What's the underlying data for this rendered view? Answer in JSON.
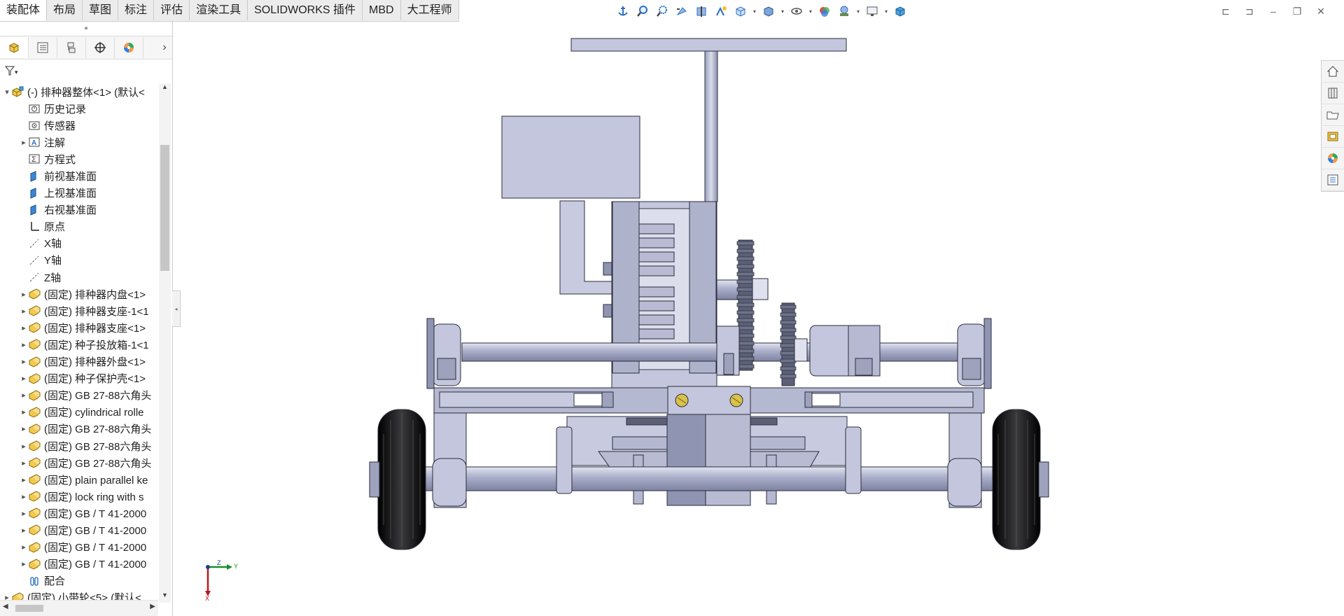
{
  "tabs": [
    "装配体",
    "布局",
    "草图",
    "标注",
    "评估",
    "渲染工具",
    "SOLIDWORKS 插件",
    "MBD",
    "大工程师"
  ],
  "active_tab": "装配体",
  "heads_up_toolbar": [
    "anchor-icon",
    "zoom-to-fit-icon",
    "zoom-area-icon",
    "previous-view-icon",
    "section-view-icon",
    "dynamic-annotation-icon",
    "view-orientation-icon",
    "display-style-icon",
    "hide-show-icon",
    "edit-appearance-icon",
    "apply-scene-icon",
    "view-settings-icon",
    "3d-view-icon"
  ],
  "panel_tabs": [
    "featuremanager-icon",
    "propertymanager-icon",
    "configurationmanager-icon",
    "dimxpert-icon",
    "display-manager-icon"
  ],
  "tree": {
    "root": "(-) 排种器整体<1> (默认<",
    "items": [
      {
        "label": "历史记录",
        "icon": "history-icon",
        "expandable": false
      },
      {
        "label": "传感器",
        "icon": "sensor-icon",
        "expandable": false
      },
      {
        "label": "注解",
        "icon": "annotation-icon",
        "expandable": true
      },
      {
        "label": "方程式",
        "icon": "equation-icon",
        "expandable": false
      },
      {
        "label": "前视基准面",
        "icon": "plane-icon",
        "expandable": false
      },
      {
        "label": "上视基准面",
        "icon": "plane-icon",
        "expandable": false
      },
      {
        "label": "右视基准面",
        "icon": "plane-icon",
        "expandable": false
      },
      {
        "label": "原点",
        "icon": "origin-icon",
        "expandable": false
      },
      {
        "label": "X轴",
        "icon": "axis-icon",
        "expandable": false
      },
      {
        "label": "Y轴",
        "icon": "axis-icon",
        "expandable": false
      },
      {
        "label": "Z轴",
        "icon": "axis-icon",
        "expandable": false
      },
      {
        "label": "(固定) 排种器内盘<1>",
        "icon": "part-icon",
        "expandable": true
      },
      {
        "label": "(固定) 排种器支座-1<1",
        "icon": "part-icon",
        "expandable": true
      },
      {
        "label": "(固定) 排种器支座<1>",
        "icon": "part-icon",
        "expandable": true
      },
      {
        "label": "(固定) 种子投放箱-1<1",
        "icon": "part-icon",
        "expandable": true
      },
      {
        "label": "(固定) 排种器外盘<1>",
        "icon": "part-icon",
        "expandable": true
      },
      {
        "label": "(固定) 种子保护壳<1>",
        "icon": "part-icon",
        "expandable": true
      },
      {
        "label": "(固定) GB 27-88六角头",
        "icon": "part-icon",
        "expandable": true
      },
      {
        "label": "(固定) cylindrical rolle",
        "icon": "part-icon",
        "expandable": true
      },
      {
        "label": "(固定) GB 27-88六角头",
        "icon": "part-icon",
        "expandable": true
      },
      {
        "label": "(固定) GB 27-88六角头",
        "icon": "part-icon",
        "expandable": true
      },
      {
        "label": "(固定) GB 27-88六角头",
        "icon": "part-icon",
        "expandable": true
      },
      {
        "label": "(固定) plain parallel ke",
        "icon": "part-icon",
        "expandable": true
      },
      {
        "label": "(固定) lock ring with s",
        "icon": "part-icon",
        "expandable": true
      },
      {
        "label": "(固定) GB / T 41-2000",
        "icon": "part-icon",
        "expandable": true
      },
      {
        "label": "(固定) GB / T 41-2000",
        "icon": "part-icon",
        "expandable": true
      },
      {
        "label": "(固定) GB / T 41-2000",
        "icon": "part-icon",
        "expandable": true
      },
      {
        "label": "(固定) GB / T 41-2000",
        "icon": "part-icon",
        "expandable": true
      },
      {
        "label": "配合",
        "icon": "mates-icon",
        "expandable": false
      }
    ],
    "last": "(固定) 小带轮<5> (默认<"
  },
  "task_pane": [
    "home-icon",
    "design-library-icon",
    "file-explorer-icon",
    "view-palette-icon",
    "appearances-icon",
    "custom-properties-icon"
  ],
  "triad": {
    "x_label": "X",
    "y_label": "Y",
    "z_label": "Z"
  },
  "colors": {
    "metal": "#c3c6dc",
    "metal_dark": "#8f94b2",
    "metal_light": "#dfe1ee",
    "edge": "#2b2d3c",
    "tire": "#121214",
    "brass": "#d9c24a",
    "blue_accent": "#2a6fc9"
  }
}
